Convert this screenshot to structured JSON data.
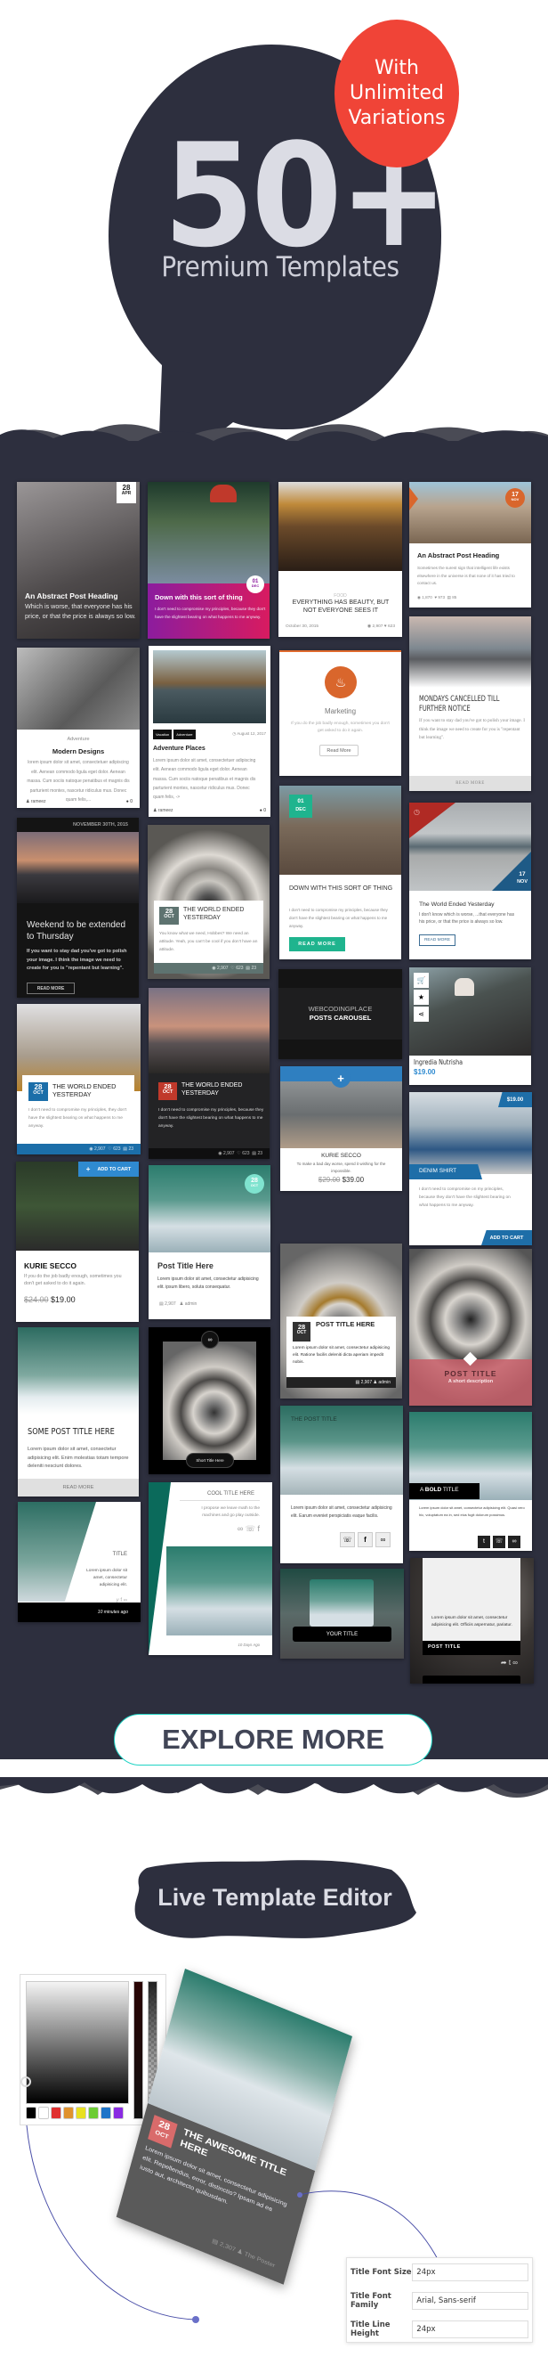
{
  "hero": {
    "number": "50+",
    "subtitle": "Premium Templates",
    "badge_lines": [
      "With",
      "Unlimited",
      "Variations"
    ],
    "colors": {
      "bubble": "#2d2f3e",
      "badge": "#f04437",
      "text": "#dbdce4"
    }
  },
  "cards": {
    "c1": {
      "day": "28",
      "month": "APR",
      "title": "An Abstract Post Heading",
      "text": "Which is worse, that everyone has his price, or that the price is always so low."
    },
    "c2": {
      "day": "01",
      "month": "DEC",
      "title": "Down with this sort of thing",
      "text": "I don't need to compromise my principles, because they don't have the slightest bearing on what happens to me anyway."
    },
    "c3": {
      "category": "FOOD",
      "title": "EVERYTHING HAS BEAUTY, BUT NOT EVERYONE SEES IT",
      "date": "October 30, 2015",
      "views": "2,907",
      "likes": "623"
    },
    "c4": {
      "day": "17",
      "month": "NOV",
      "title": "An Abstract Post Heading",
      "text": "Sometimes the surest sign that intelligent life exists elsewhere in the universe is that none of it has tried to contact us.",
      "views": "1,870",
      "likes": "973",
      "comments": "85"
    },
    "c5": {
      "category": "Adventure",
      "title": "Modern Designs",
      "text": "lorem ipsum dolor sit amet, consectetuer adipiscing elit. Aenean commodo ligula eget dolor. Aenean massa. Cum sociis natoque penatibus et magnis dis parturient montes, nascetur ridiculus mus. Donec quam felis,...",
      "author": "rameez",
      "comments": "0"
    },
    "c6": {
      "tags": [
        "Vacation",
        "Adventure"
      ],
      "date": "August 12, 2017",
      "title": "Adventure Places",
      "text": "Lorem ipsum dolor sit amet, consectetuer adipiscing elit. Aenean commodo ligula eget dolor. Aenean massa. Cum sociis natoque penatibus et magnis dis parturient montes, nascetur ridiculus mus. Donec quam felis, ->",
      "author": "rameez",
      "comments": "0"
    },
    "c7": {
      "icon_label": "Marketing",
      "text": "If you do the job badly enough, sometimes you don't get asked to do it again.",
      "button": "Read More"
    },
    "c8": {
      "title": "MONDAYS CANCELLED TILL FURTHER NOTICE",
      "text": "If you want to stay dad you've got to polish your image. I think the image we need to create for you is \"repentant but learning\".",
      "button": "READ MORE"
    },
    "c9": {
      "date": "NOVEMBER 30TH, 2015",
      "title": "Weekend to be extended to Thursday",
      "text": "If you want to stay dad you've got to polish your image. I think the image we need to create for you is \"repentant but learning\".",
      "button": "READ MORE"
    },
    "c10": {
      "day": "28",
      "month": "OCT",
      "title": "THE WORLD ENDED YESTERDAY",
      "text": "You know what we need, Hobbes? We need an attitude. Yeah, you can't be cool if you don't have an attitude.",
      "views": "2,907",
      "likes": "623",
      "comments": "23"
    },
    "c11": {
      "day": "01",
      "month": "DEC",
      "title": "DOWN WITH THIS SORT OF THING",
      "text": "I don't need to compromise my principles, because they don't have the slightest bearing on what happens to me anyway.",
      "button": "READ MORE"
    },
    "c12": {
      "day": "17",
      "month": "NOV",
      "title": "The World Ended Yesterday",
      "text": "I don't know which is worse, ...that everyone has his price, or that the price is always so low.",
      "button": "READ MORE"
    },
    "c13": {
      "day": "28",
      "month": "OCT",
      "title": "THE WORLD ENDED YESTERDAY",
      "text": "I don't need to compromise my principles, they don't have the slightest bearing on what happens to me anyway.",
      "views": "2,907",
      "likes": "623",
      "comments": "23"
    },
    "c14": {
      "day": "28",
      "month": "OCT",
      "title": "THE WORLD ENDED YESTERDAY",
      "text": "I don't need to compromise my principles, because they don't have the slightest bearing on what happens to me anyway.",
      "views": "2,907",
      "likes": "623",
      "comments": "23"
    },
    "c15": {
      "line1": "WEBCODINGPLACE",
      "line2": "POSTS CAROUSEL"
    },
    "c16": {
      "title": "Ingredia Nutrisha",
      "price": "$19.00"
    },
    "c17": {
      "button": "ADD TO CART",
      "title": "KURIE SECCO",
      "text": "If you do the job badly enough, sometimes you don't get asked to do it again.",
      "old_price": "$24.00",
      "price": "$19.00"
    },
    "c18": {
      "day": "28",
      "month": "OCT",
      "title": "Post Title Here",
      "text": "Lorem ipsum dolor sit amet, consectetur adipisicing elit. ipsum libero, soluta consequatur.",
      "comments": "2,907",
      "author": "admin"
    },
    "c19": {
      "title": "KURIE SECCO",
      "text": "To make a bad day worse, spend it wishing for the impossible.",
      "old_price": "$29.00",
      "price": "$39.00"
    },
    "c20": {
      "price": "$19.00",
      "title": "DENIM SHIRT",
      "text": "I don't need to compromise on my principles, because they don't have the slightest bearing on what happens to me anyway.",
      "button": "ADD TO CART"
    },
    "c21": {
      "title": "SOME POST TITLE HERE",
      "text": "Lorem ipsum dolor sit amet, consectetur adipisicing elit. Enim molestias totam tempore deleniti nesciunt dolores.",
      "button": "READ MORE"
    },
    "c22": {
      "title": "Short Title Here"
    },
    "c23": {
      "day": "28",
      "month": "OCT",
      "title": "POST TITLE HERE",
      "text": "Lorem ipsum dolor sit amet, consectetur adipisicing elit. Ratione facilis deleniti dicta aperiam impedit nobis.",
      "comments": "2,907",
      "author": "admin"
    },
    "c24": {
      "title": "POST TITLE",
      "subtitle": "A short description"
    },
    "c25": {
      "title": "TITLE",
      "text": "Lorem ipsum dolor sit amet, consectetur adipisicing elit.",
      "time": "10 minutes ago"
    },
    "c26": {
      "title": "COOL TITLE HERE",
      "text": "I propose we leave math to the machines and go play outside.",
      "time": "10 Days Ago"
    },
    "c27": {
      "title": "THE POST TITLE",
      "text": "Lorem ipsum dolor sit amet, consectetur adipisicing elit. Earum eveniet perspiciatis eaque facilis."
    },
    "c28": {
      "title_pre": "A ",
      "title_bold": "BOLD",
      "title_post": " TITLE",
      "text": "Lorem ipsum dolor sit amet, consectetur adipisicing elit. Quasi vero hic, voluptatum ea in, sed eius fugit dolorum possimus."
    },
    "c29": {
      "title": "YOUR TITLE"
    },
    "c30": {
      "text": "Lorem ipsum dolor sit amet, consectetur adipisicing elit. Officiis aspernatur, pariatur.",
      "title": "POST TITLE"
    }
  },
  "explore_button": "EXPLORE MORE",
  "editor": {
    "title": "Live Template Editor",
    "preview": {
      "day": "28",
      "month": "OCT",
      "title": "THE AWESOME TITLE HERE",
      "text": "Lorem ipsum dolor sit amet, consectetur adipisicing elit. Repellendus, error, distinctio? Ipsam ad ea iusto aut, architecto quibusdam.",
      "comments": "2,307",
      "author": "The Poster"
    },
    "swatches": [
      "#000000",
      "#ffffff",
      "#e03030",
      "#e0922e",
      "#e8e020",
      "#6ccc34",
      "#1e74c8",
      "#8a2be2"
    ],
    "fields": [
      {
        "label": "Title Font Size",
        "value": "24px"
      },
      {
        "label": "Title Font Family",
        "value": "Arial, Sans-serif"
      },
      {
        "label": "Title Line Height",
        "value": "24px"
      }
    ]
  }
}
